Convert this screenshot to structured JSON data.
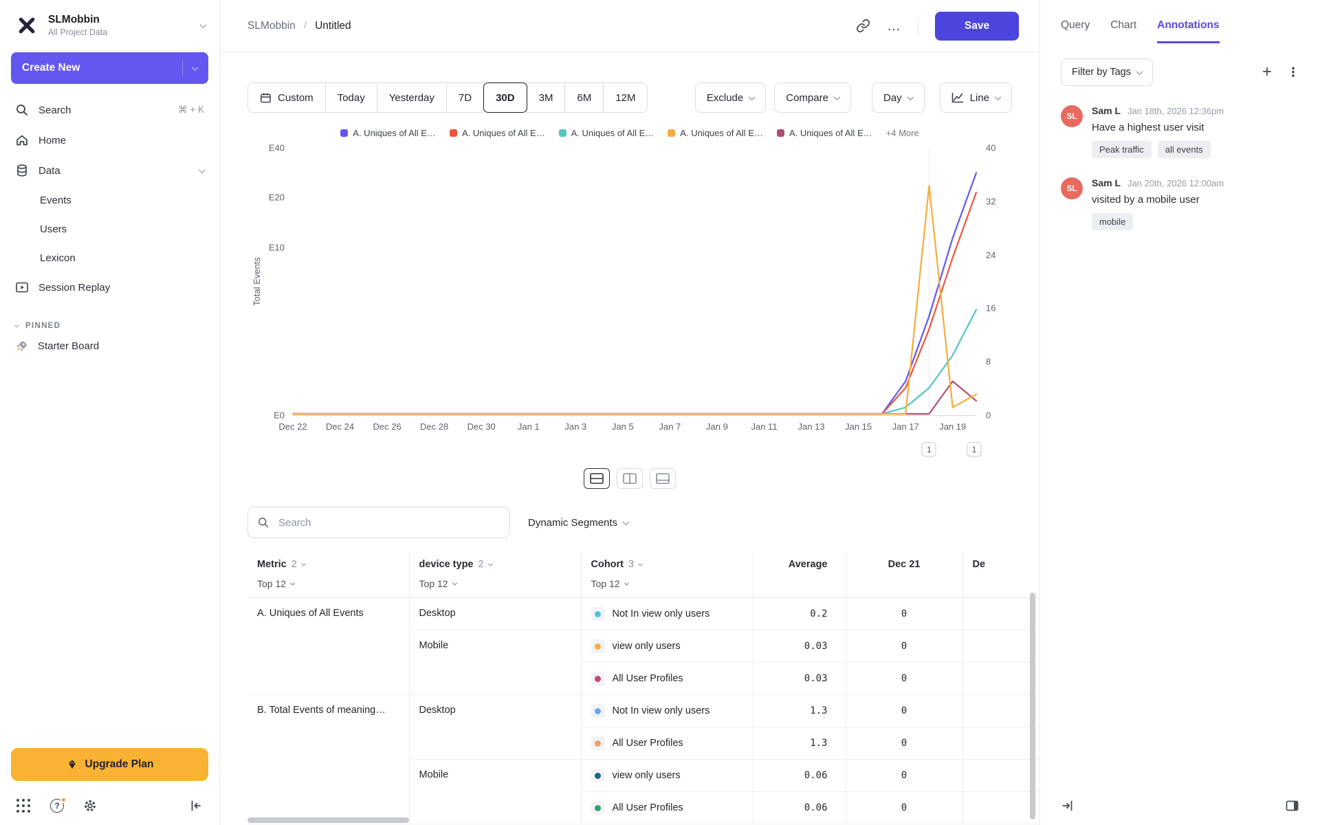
{
  "colors": {
    "accent_purple": "#6257f0",
    "save_button": "#4b45dd",
    "upgrade_amber": "#f9b234",
    "avatar_orange": "#e8695e",
    "active_tab_purple": "#5848e5"
  },
  "icons": {
    "help_glyph": "?",
    "more_glyph": "…",
    "kebab_glyph": "⋮",
    "plus_glyph": "+",
    "breadcrumb_separator": "/"
  },
  "sidebar": {
    "workspace_name": "SLMobbin",
    "workspace_subtitle": "All Project Data",
    "create_new_label": "Create New",
    "search_label": "Search",
    "search_shortcut": "⌘ + K",
    "home_label": "Home",
    "data_label": "Data",
    "data_children": [
      "Events",
      "Users",
      "Lexicon"
    ],
    "session_replay_label": "Session Replay",
    "pinned_label": "PINNED",
    "starter_board_label": "Starter Board",
    "upgrade_label": "Upgrade Plan"
  },
  "header": {
    "breadcrumb_workspace": "SLMobbin",
    "breadcrumb_page": "Untitled",
    "save_label": "Save"
  },
  "toolbar": {
    "date_ranges": [
      "Custom",
      "Today",
      "Yesterday",
      "7D",
      "30D",
      "3M",
      "6M",
      "12M"
    ],
    "selected_range": "30D",
    "exclude_label": "Exclude",
    "compare_label": "Compare",
    "granularity_label": "Day",
    "chart_type_label": "Line"
  },
  "chart": {
    "y_axis_label": "Total Events",
    "left_ticks": [
      "E40",
      "E20",
      "E10",
      "E0"
    ],
    "right_ticks": [
      "40",
      "32",
      "24",
      "16",
      "8",
      "0"
    ],
    "legend_more_label": "+4 More",
    "annotation_markers": [
      "1",
      "1"
    ]
  },
  "chart_data": {
    "type": "line",
    "title": "",
    "xlabel": "",
    "ylabel": "Total Events",
    "ylim": [
      0,
      40
    ],
    "x_tick_step": 2,
    "legend_position": "top",
    "left_axis_labels": [
      "E40",
      "E20",
      "E10",
      "E0"
    ],
    "x": [
      "Dec 22",
      "Dec 23",
      "Dec 24",
      "Dec 25",
      "Dec 26",
      "Dec 27",
      "Dec 28",
      "Dec 29",
      "Dec 30",
      "Dec 31",
      "Jan 1",
      "Jan 2",
      "Jan 3",
      "Jan 4",
      "Jan 5",
      "Jan 6",
      "Jan 7",
      "Jan 8",
      "Jan 9",
      "Jan 10",
      "Jan 11",
      "Jan 12",
      "Jan 13",
      "Jan 14",
      "Jan 15",
      "Jan 16",
      "Jan 17",
      "Jan 18",
      "Jan 19",
      "Jan 20"
    ],
    "draw_order": [
      0,
      1,
      2,
      4,
      3
    ],
    "series": [
      {
        "name": "A. Uniques of All E…",
        "color": "#6257f0",
        "values": [
          0,
          0,
          0,
          0,
          0,
          0,
          0,
          0,
          0,
          0,
          0,
          0,
          0,
          0,
          0,
          0,
          0,
          0,
          0,
          0,
          0,
          0,
          0,
          0,
          0,
          0,
          5,
          15,
          27,
          37
        ]
      },
      {
        "name": "A. Uniques of All E…",
        "color": "#ee553c",
        "values": [
          0,
          0,
          0,
          0,
          0,
          0,
          0,
          0,
          0,
          0,
          0,
          0,
          0,
          0,
          0,
          0,
          0,
          0,
          0,
          0,
          0,
          0,
          0,
          0,
          0,
          0,
          4,
          13,
          24,
          34
        ]
      },
      {
        "name": "A. Uniques of All E…",
        "color": "#53c6bf",
        "values": [
          0,
          0,
          0,
          0,
          0,
          0,
          0,
          0,
          0,
          0,
          0,
          0,
          0,
          0,
          0,
          0,
          0,
          0,
          0,
          0,
          0,
          0,
          0,
          0,
          0,
          0,
          1,
          4,
          9,
          16
        ]
      },
      {
        "name": "A. Uniques of All E…",
        "color": "#f5ab3d",
        "values": [
          0,
          0,
          0,
          0,
          0,
          0,
          0,
          0,
          0,
          0,
          0,
          0,
          0,
          0,
          0,
          0,
          0,
          0,
          0,
          0,
          0,
          0,
          0,
          0,
          0,
          0,
          0,
          35,
          1,
          3
        ]
      },
      {
        "name": "A. Uniques of All E…",
        "color": "#b04f6d",
        "values": [
          0,
          0,
          0,
          0,
          0,
          0,
          0,
          0,
          0,
          0,
          0,
          0,
          0,
          0,
          0,
          0,
          0,
          0,
          0,
          0,
          0,
          0,
          0,
          0,
          0,
          0,
          0,
          0,
          5,
          2
        ]
      }
    ]
  },
  "table": {
    "search_placeholder": "Search",
    "segments_label": "Dynamic Segments",
    "columns": {
      "metric": {
        "label": "Metric",
        "count": "2",
        "top": "Top 12"
      },
      "device": {
        "label": "device type",
        "count": "2",
        "top": "Top 12"
      },
      "cohort": {
        "label": "Cohort",
        "count": "3",
        "top": "Top 12"
      },
      "average": {
        "label": "Average"
      },
      "dec21": {
        "label": "Dec 21"
      },
      "next": {
        "label": "De"
      }
    },
    "groups": [
      {
        "metric": "A. Uniques of All Events",
        "devices": [
          {
            "device": "Desktop",
            "cohorts": [
              {
                "name": "Not In view only users",
                "color": "#56c4d8",
                "avg": "0.2",
                "dec21": "0"
              }
            ]
          },
          {
            "device": "Mobile",
            "cohorts": [
              {
                "name": "view only users",
                "color": "#f2b13c",
                "avg": "0.03",
                "dec21": "0"
              },
              {
                "name": "All User Profiles",
                "color": "#c04a6b",
                "avg": "0.03",
                "dec21": "0"
              }
            ]
          }
        ]
      },
      {
        "metric": "B. Total Events of meaning…",
        "devices": [
          {
            "device": "Desktop",
            "cohorts": [
              {
                "name": "Not In view only users",
                "color": "#6aa9f0",
                "avg": "1.3",
                "dec21": "0"
              },
              {
                "name": "All User Profiles",
                "color": "#f59d68",
                "avg": "1.3",
                "dec21": "0"
              }
            ]
          },
          {
            "device": "Mobile",
            "cohorts": [
              {
                "name": "view only users",
                "color": "#176a80",
                "avg": "0.06",
                "dec21": "0"
              },
              {
                "name": "All User Profiles",
                "color": "#33a06a",
                "avg": "0.06",
                "dec21": "0"
              }
            ]
          }
        ]
      }
    ]
  },
  "annotations": {
    "tabs": [
      "Query",
      "Chart",
      "Annotations"
    ],
    "active_tab": "Annotations",
    "filter_label": "Filter by Tags",
    "items": [
      {
        "initials": "SL",
        "author": "Sam L",
        "timestamp": "Jan 18th, 2026 12:36pm",
        "text": "Have a highest user visit",
        "tags": [
          "Peak traffic",
          "all events"
        ]
      },
      {
        "initials": "SL",
        "author": "Sam L",
        "timestamp": "Jan 20th, 2026 12:00am",
        "text": "visited by a mobile user",
        "tags": [
          "mobile"
        ]
      }
    ]
  }
}
